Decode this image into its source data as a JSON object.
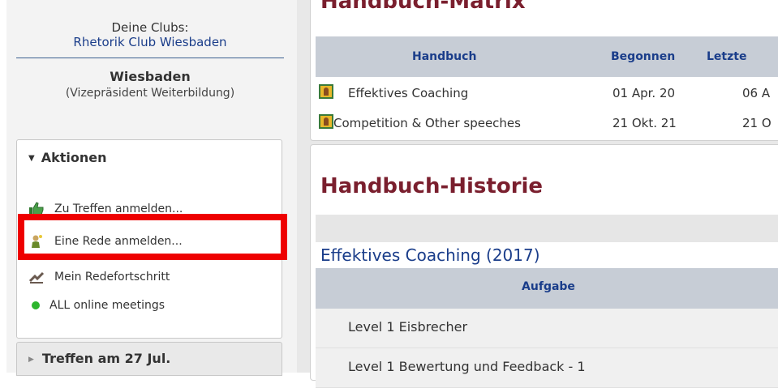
{
  "sidebar": {
    "clubs_label": "Deine Clubs:",
    "club_link": "Rhetorik Club Wiesbaden",
    "club_name": "Wiesbaden",
    "club_role": "(Vizepräsident Weiterbildung)",
    "actions": {
      "header": "Aktionen",
      "items": [
        {
          "label": "Zu Treffen anmelden...",
          "icon": "thumbs-up-icon"
        },
        {
          "label": "Eine Rede anmelden...",
          "icon": "speaker-icon"
        },
        {
          "label": "Mein Redefortschritt",
          "icon": "progress-icon"
        },
        {
          "label": "ALL online meetings",
          "icon": "green-dot-icon"
        }
      ]
    },
    "meeting": {
      "label": "Treffen am 27 Jul."
    }
  },
  "main": {
    "matrix": {
      "title": "Handbuch-Matrix",
      "columns": [
        "Handbuch",
        "Begonnen",
        "Letzte"
      ],
      "rows": [
        {
          "book": "Effektives Coaching",
          "started": "01 Apr. 20",
          "last": "06 A"
        },
        {
          "book": "Competition & Other speeches",
          "started": "21 Okt. 21",
          "last": "21 O"
        }
      ]
    },
    "history": {
      "title": "Handbuch-Historie",
      "subtitle": "Effektives Coaching (2017)",
      "column": "Aufgabe",
      "rows": [
        "Level 1 Eisbrecher",
        "Level 1 Bewertung und Feedback - 1"
      ]
    }
  },
  "colors": {
    "accent_title": "#7a1f2e",
    "link": "#1a3d8a",
    "highlight": "#ee0000"
  }
}
